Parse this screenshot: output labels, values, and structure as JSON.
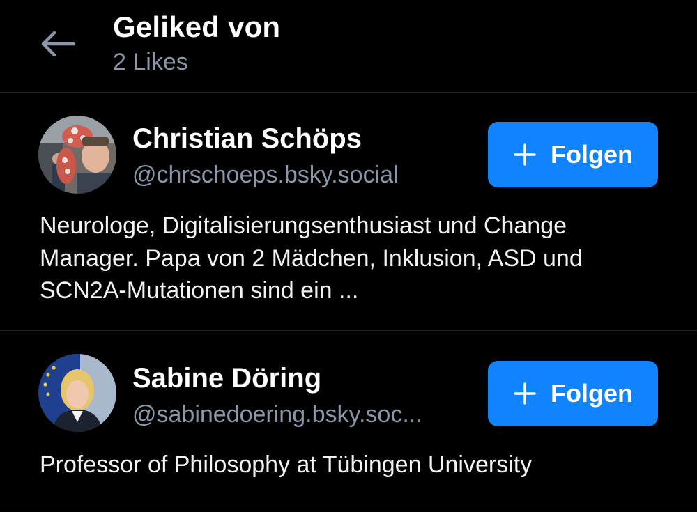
{
  "header": {
    "title": "Geliked von",
    "subtitle": "2 Likes",
    "back_icon": "arrow-left-icon"
  },
  "users": [
    {
      "display_name": "Christian Schöps",
      "handle": "@chrschoeps.bsky.social",
      "follow_label": "Folgen",
      "bio": "Neurologe, Digitalisierungsenthusiast und Change Manager. Papa von 2 Mädchen, Inklusion, ASD und SCN2A-Mutationen sind ein ..."
    },
    {
      "display_name": "Sabine Döring",
      "handle": "@sabinedoering.bsky.soc...",
      "follow_label": "Folgen",
      "bio": "Professor of Philosophy at Tübingen University"
    }
  ],
  "colors": {
    "background": "#000000",
    "accent": "#1083fe",
    "secondary_text": "#8b97a8",
    "divider": "#1e232b"
  }
}
